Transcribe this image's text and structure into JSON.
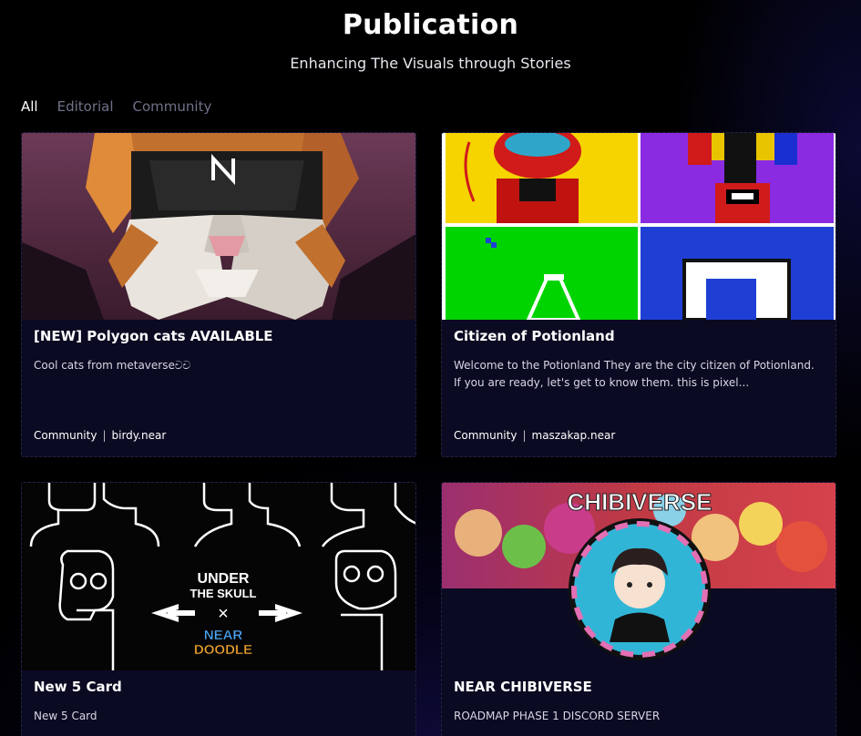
{
  "header": {
    "title": "Publication",
    "subtitle": "Enhancing The Visuals through Stories"
  },
  "tabs": [
    {
      "label": "All",
      "active": true
    },
    {
      "label": "Editorial",
      "active": false
    },
    {
      "label": "Community",
      "active": false
    }
  ],
  "cards": [
    {
      "title": "[NEW] Polygon cats AVAILABLE",
      "description": "Cool cats from metaverseචච",
      "category": "Community",
      "author": "birdy.near",
      "image_icon": "polygon-cat-image"
    },
    {
      "title": "Citizen of Potionland",
      "description": "Welcome to the Potionland They are the city citizen of Potionland. If you are ready, let's get to know them. this is pixel...",
      "category": "Community",
      "author": "maszakap.near",
      "image_icon": "pixel-citizens-image"
    },
    {
      "title": "New 5 Card",
      "description": "New 5 Card",
      "category": "",
      "author": "",
      "image_icon": "under-the-skull-image",
      "image_text": {
        "line1": "UNDER",
        "line2": "THE SKULL",
        "cross": "×",
        "brand1": "NEAR",
        "brand2": "DOODLE"
      }
    },
    {
      "title": "NEAR CHIBIVERSE",
      "description": "ROADMAP PHASE 1 DISCORD SERVER",
      "category": "",
      "author": "",
      "image_icon": "chibiverse-image",
      "image_text": {
        "banner": "CHIBIVERSE"
      }
    }
  ],
  "colors": {
    "background": "#000000",
    "card_bg": "#0a0a22",
    "tab_inactive": "#6f7189"
  }
}
